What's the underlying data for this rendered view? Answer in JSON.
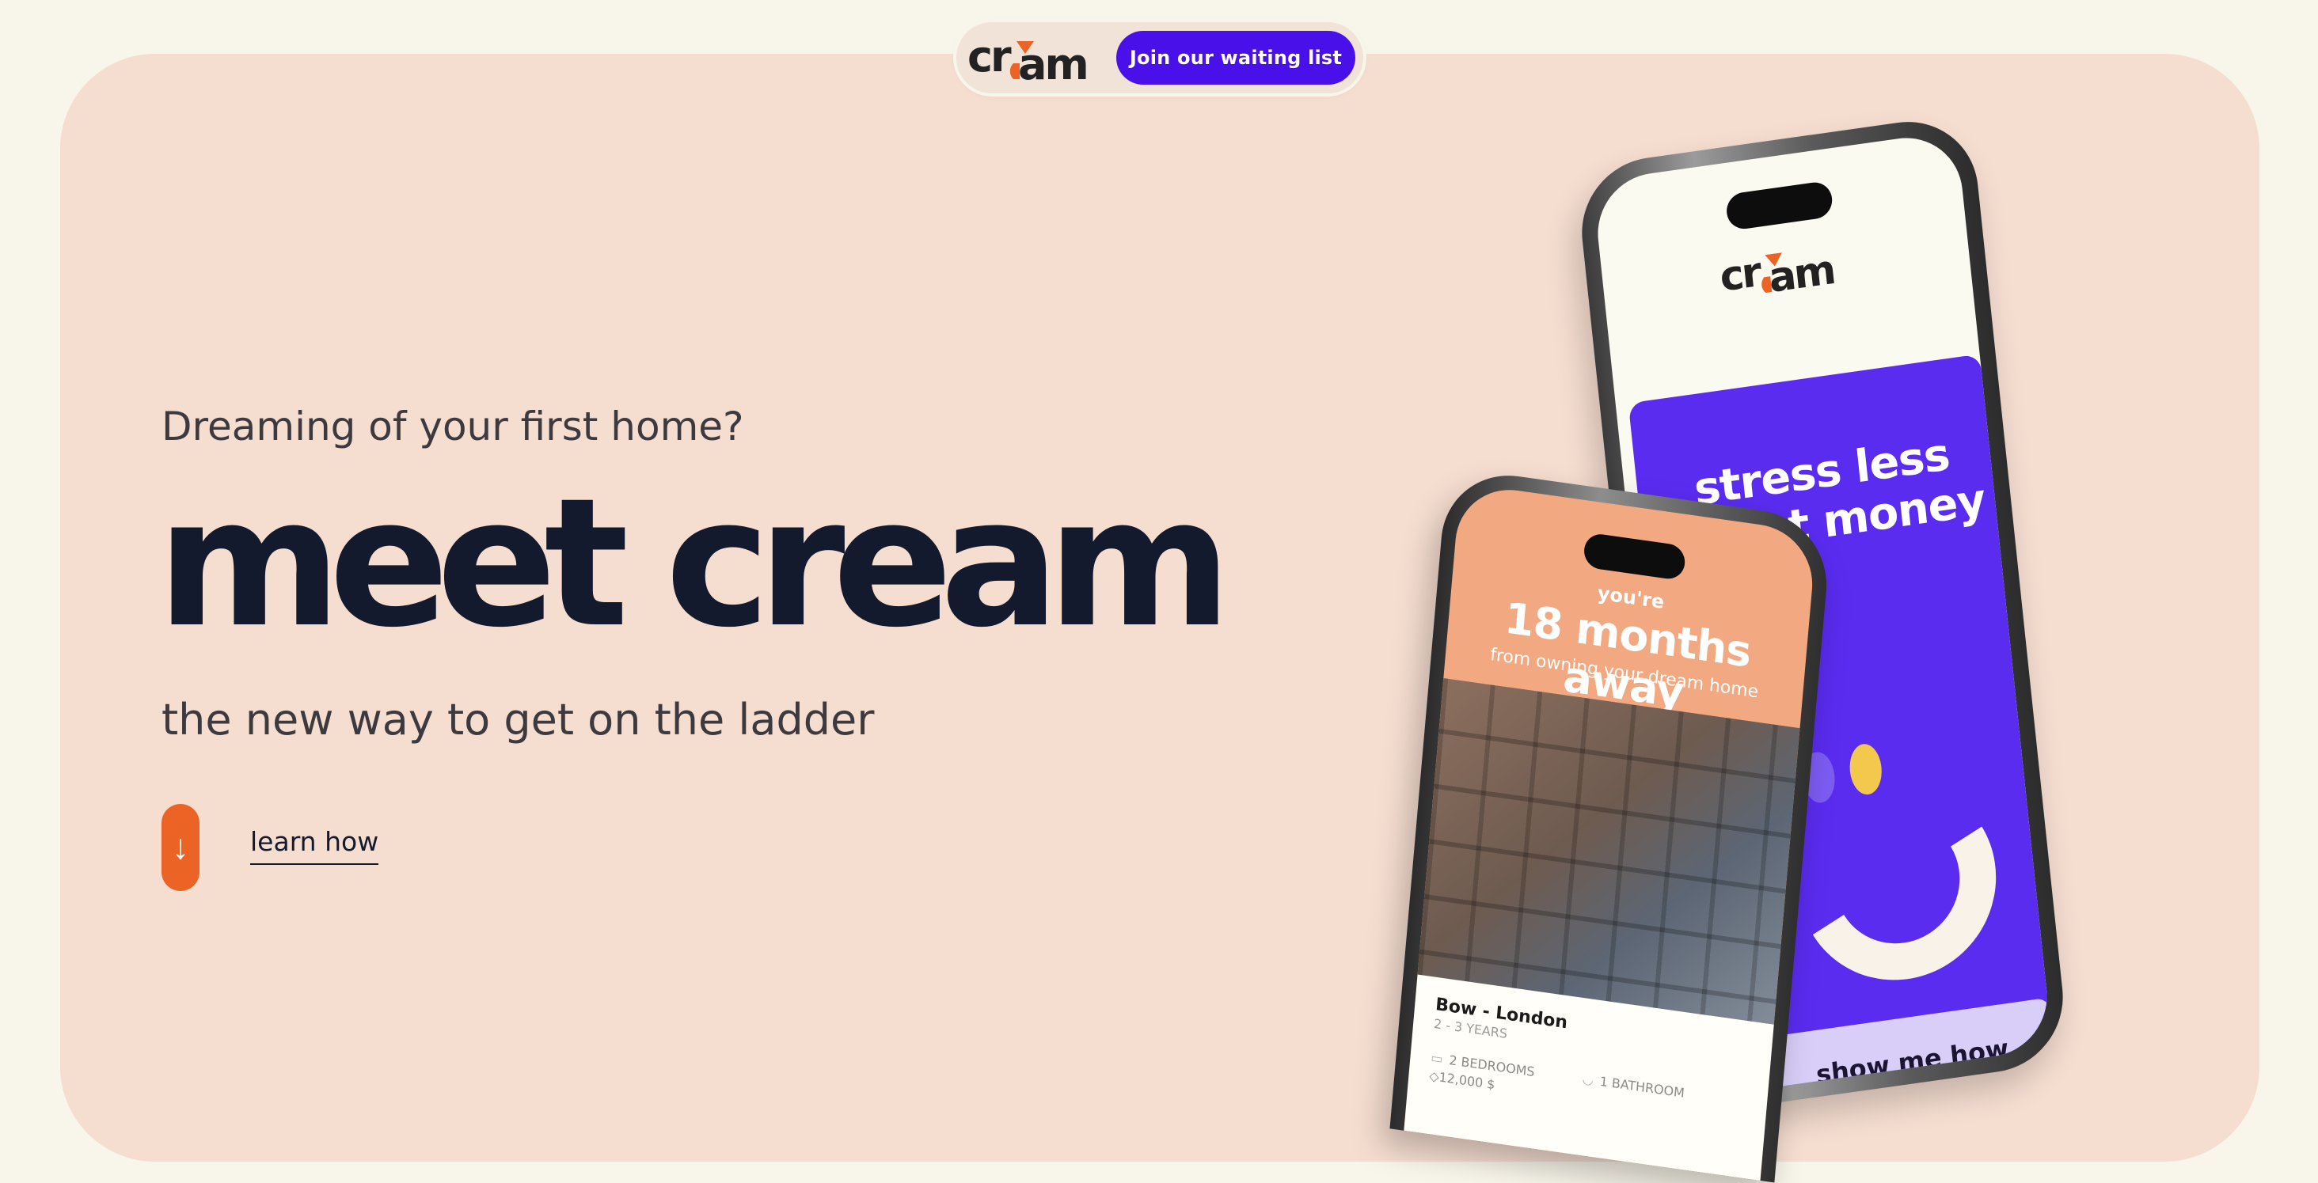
{
  "brand": {
    "name": "cream",
    "accent_orange": "#ec6326",
    "accent_purple": "#4a10ea"
  },
  "nav": {
    "cta_label": "Join our waiting list"
  },
  "hero": {
    "eyebrow": "Dreaming of your first home?",
    "headline": "meet cream",
    "subheadline": "the new way to get on the ladder",
    "learn_button_icon": "↓",
    "learn_label": "learn how"
  },
  "phone_back": {
    "title_line1": "stress less",
    "title_line2": "about money",
    "button_label": "show me how"
  },
  "phone_front": {
    "pre": "you're",
    "headline": "18 months away",
    "post": "from owning your dream home",
    "location": "Bow - London",
    "years": "2 - 3 YEARS",
    "bedrooms": "2 BEDROOMS",
    "bathrooms": "1 BATHROOM",
    "price": "12,000 $"
  }
}
